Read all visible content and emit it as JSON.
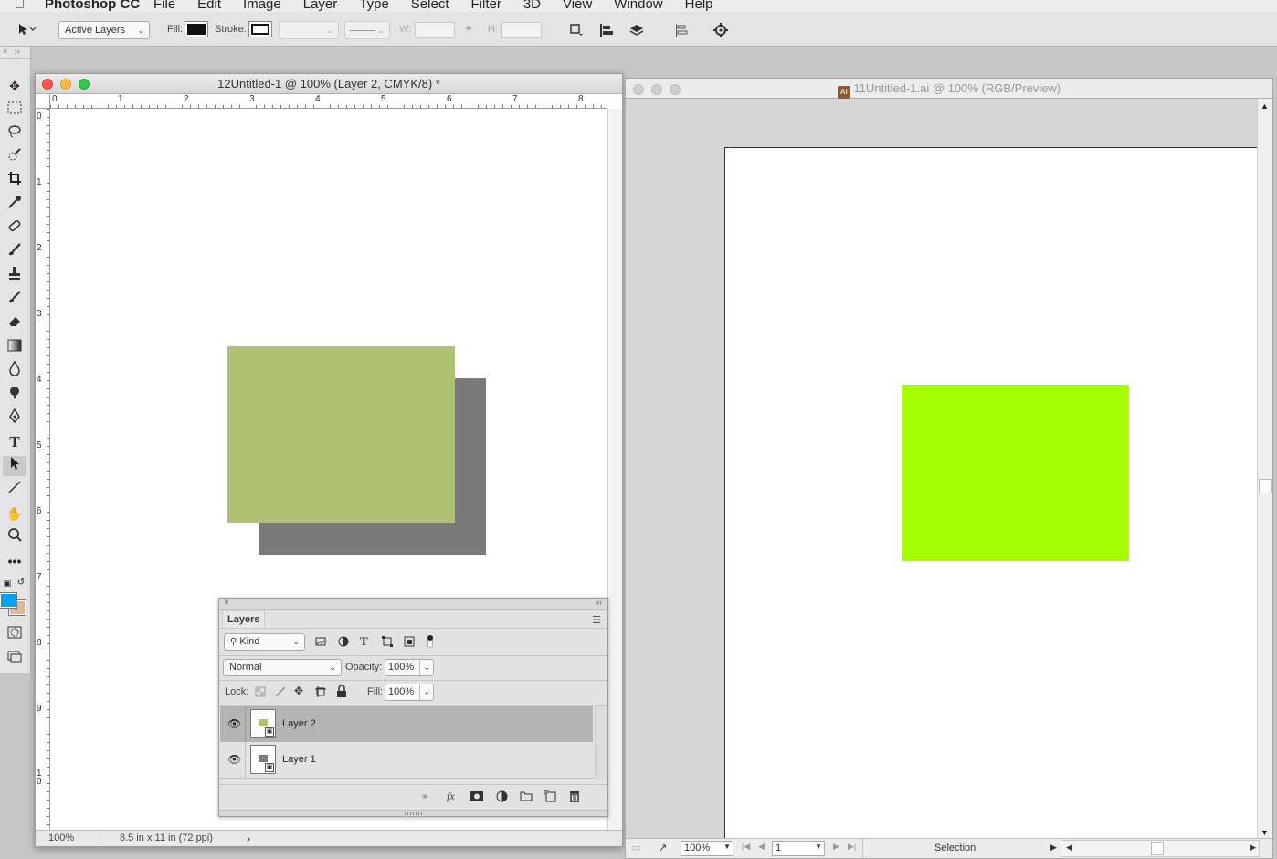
{
  "menubar": {
    "apple": "",
    "app_name": "Photoshop CC",
    "menus": [
      "File",
      "Edit",
      "Image",
      "Layer",
      "Type",
      "Select",
      "Filter",
      "3D",
      "View",
      "Window",
      "Help"
    ]
  },
  "options": {
    "select_mode": "Active Layers",
    "fill_label": "Fill:",
    "stroke_label": "Stroke:",
    "w_label": "W:",
    "h_label": "H:"
  },
  "ps_window": {
    "title": "12Untitled-1 @ 100% (Layer 2, CMYK/8) *",
    "ruler_h": [
      "0",
      "1",
      "2",
      "3",
      "4",
      "5",
      "6",
      "7",
      "8"
    ],
    "ruler_v": [
      "0",
      "1",
      "2",
      "3",
      "4",
      "5",
      "6",
      "7",
      "8",
      "9",
      "1\n0"
    ],
    "zoom": "100%",
    "doc_info": "8.5 in x 11 in (72 ppi)",
    "status_arrow": "›"
  },
  "layers_panel": {
    "close": "×",
    "collapse": "‹‹",
    "title": "Layers",
    "filter_kind": "Kind",
    "blend_mode": "Normal",
    "opacity_label": "Opacity:",
    "opacity_value": "100%",
    "lock_label": "Lock:",
    "fill_label": "Fill:",
    "fill_value": "100%",
    "layers": [
      {
        "name": "Layer 2",
        "selected": true,
        "color": "#aec271"
      },
      {
        "name": "Layer 1",
        "selected": false,
        "color": "#7a7a7a"
      }
    ]
  },
  "ai_window": {
    "title": "11Untitled-1.ai @ 100% (RGB/Preview)",
    "zoom": "100%",
    "artboard_number": "1",
    "status_mode": "Selection"
  },
  "colors": {
    "fg": "#00a3f2",
    "bg": "#e1b59a",
    "green_rect": "#aec271",
    "gray_rect": "#7a7a7a",
    "lime_rect": "#a6ff00"
  }
}
